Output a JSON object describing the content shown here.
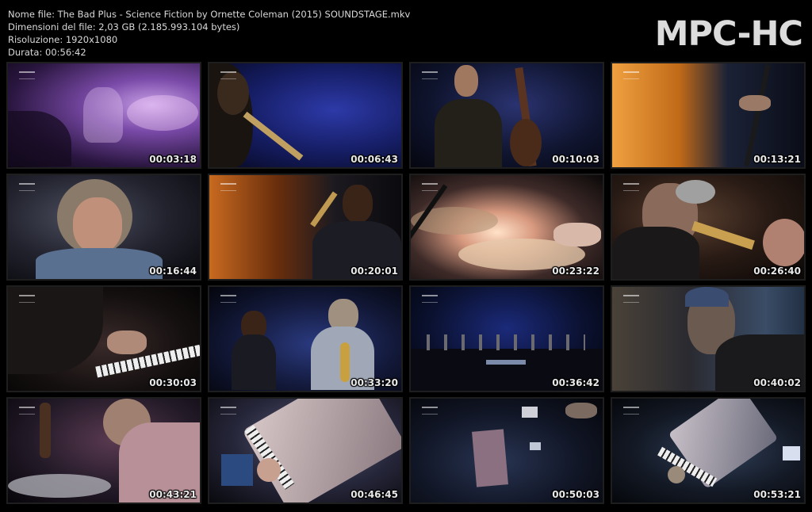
{
  "info": {
    "file_name": "Nome file: The Bad Plus - Science Fiction by Ornette Coleman (2015) SOUNDSTAGE.mkv",
    "file_size": "Dimensioni del file: 2,03 GB (2.185.993.104 bytes)",
    "resolution": "Risoluzione: 1920x1080",
    "duration": "Durata: 00:56:42"
  },
  "logo": "MPC-HC",
  "thumbnails": [
    {
      "time": "00:03:18",
      "scene": "blurred-purple-stage"
    },
    {
      "time": "00:06:43",
      "scene": "saxophonist-blue"
    },
    {
      "time": "00:10:03",
      "scene": "bassist-singing"
    },
    {
      "time": "00:13:21",
      "scene": "orange-light-bass"
    },
    {
      "time": "00:16:44",
      "scene": "pianist-glasses"
    },
    {
      "time": "00:20:01",
      "scene": "saxophonist-suit"
    },
    {
      "time": "00:23:22",
      "scene": "drum-cymbal-closeup"
    },
    {
      "time": "00:26:40",
      "scene": "trumpeter"
    },
    {
      "time": "00:30:03",
      "scene": "piano-keys-hands"
    },
    {
      "time": "00:33:20",
      "scene": "two-saxophonists"
    },
    {
      "time": "00:36:42",
      "scene": "full-stage-wide"
    },
    {
      "time": "00:40:02",
      "scene": "bassist-closeup"
    },
    {
      "time": "00:43:21",
      "scene": "drummer-and-cellist"
    },
    {
      "time": "00:46:45",
      "scene": "piano-overhead"
    },
    {
      "time": "00:50:03",
      "scene": "stage-overhead-dark"
    },
    {
      "time": "00:53:21",
      "scene": "piano-overhead-wide"
    }
  ]
}
